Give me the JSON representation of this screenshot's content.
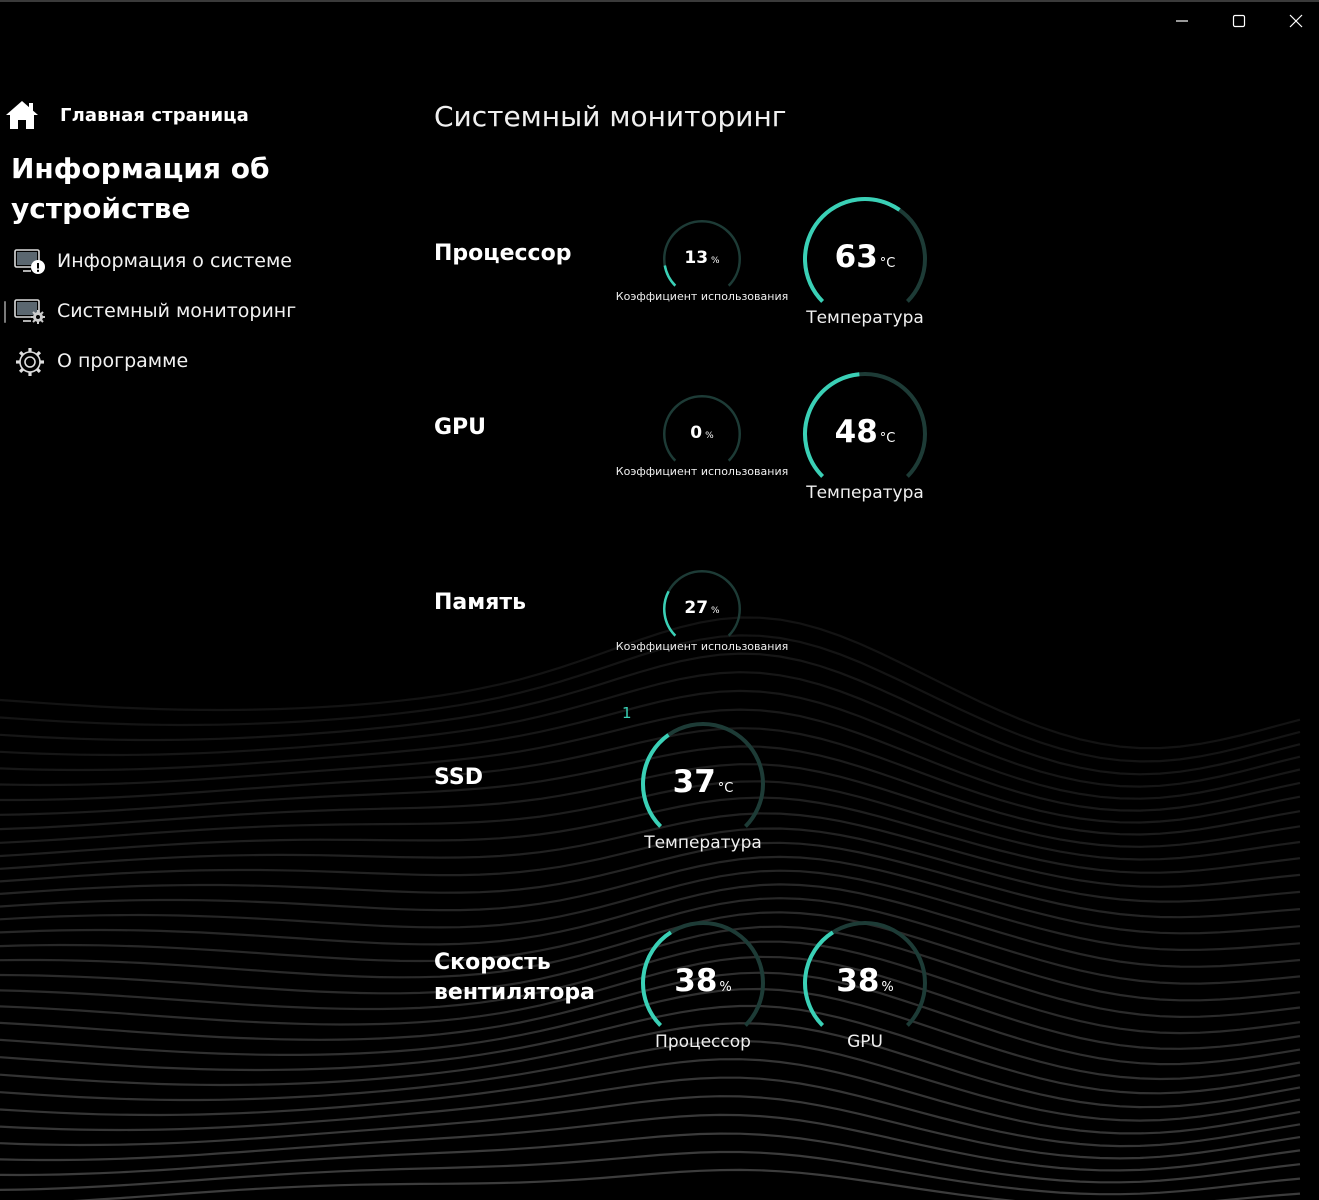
{
  "window": {
    "controls": [
      "minimize",
      "maximize",
      "close"
    ]
  },
  "sidebar": {
    "home_label": "Главная страница",
    "section_title": "Информация об устройстве",
    "items": [
      {
        "label": "Информация о системе",
        "icon": "monitor-info-icon",
        "selected": false
      },
      {
        "label": "Системный мониторинг",
        "icon": "monitor-gear-icon",
        "selected": true
      },
      {
        "label": "О программе",
        "icon": "gear-icon",
        "selected": false
      }
    ]
  },
  "main": {
    "title": "Системный мониторинг",
    "cpu": {
      "label": "Процессор",
      "usage": {
        "value": "13",
        "unit": "%",
        "label": "Коэффициент использования",
        "fraction": 0.13
      },
      "temperature": {
        "value": "63",
        "unit": "°C",
        "label": "Температура",
        "fraction": 0.63
      }
    },
    "gpu": {
      "label": "GPU",
      "usage": {
        "value": "0",
        "unit": "%",
        "label": "Коэффициент использования",
        "fraction": 0.0
      },
      "temperature": {
        "value": "48",
        "unit": "°C",
        "label": "Температура",
        "fraction": 0.48
      }
    },
    "memory": {
      "label": "Память",
      "usage": {
        "value": "27",
        "unit": "%",
        "label": "Коэффициент использования",
        "fraction": 0.27
      }
    },
    "ssd": {
      "label": "SSD",
      "index": "1",
      "temperature": {
        "value": "37",
        "unit": "°C",
        "label": "Температура",
        "fraction": 0.37
      }
    },
    "fan": {
      "label_line1": "Скорость",
      "label_line2": "вентилятора",
      "cpu": {
        "value": "38",
        "unit": "%",
        "label": "Процессор",
        "fraction": 0.38
      },
      "gpu": {
        "value": "38",
        "unit": "%",
        "label": "GPU",
        "fraction": 0.38
      }
    }
  },
  "colors": {
    "accent": "#3ad0b6",
    "track": "#1d3b36",
    "background": "#000000"
  }
}
